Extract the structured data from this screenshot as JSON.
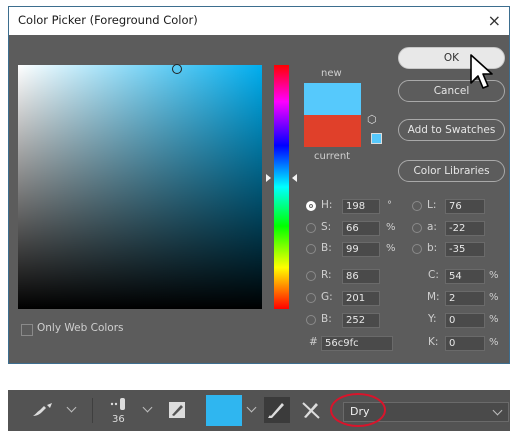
{
  "dialog": {
    "title": "Color Picker (Foreground Color)",
    "close": "×",
    "labels": {
      "new": "new",
      "current": "current"
    },
    "buttons": {
      "ok": "OK",
      "cancel": "Cancel",
      "add_to_swatches": "Add to Swatches",
      "color_libraries": "Color Libraries"
    },
    "colors": {
      "new": "#56c9fc",
      "current": "#e0402a"
    },
    "fields": {
      "hsb": [
        {
          "label": "H:",
          "value": "198",
          "unit": "°"
        },
        {
          "label": "S:",
          "value": "66",
          "unit": "%"
        },
        {
          "label": "B:",
          "value": "99",
          "unit": "%"
        }
      ],
      "rgb": [
        {
          "label": "R:",
          "value": "86"
        },
        {
          "label": "G:",
          "value": "201"
        },
        {
          "label": "B:",
          "value": "252"
        }
      ],
      "lab": [
        {
          "label": "L:",
          "value": "76"
        },
        {
          "label": "a:",
          "value": "-22"
        },
        {
          "label": "b:",
          "value": "-35"
        }
      ],
      "cmyk": [
        {
          "label": "C:",
          "value": "54",
          "unit": "%"
        },
        {
          "label": "M:",
          "value": "2",
          "unit": "%"
        },
        {
          "label": "Y:",
          "value": "0",
          "unit": "%"
        },
        {
          "label": "K:",
          "value": "0",
          "unit": "%"
        }
      ],
      "hex": {
        "label": "#",
        "value": "56c9fc"
      }
    },
    "only_web_colors": "Only Web Colors"
  },
  "toolbar": {
    "brush_size": "36",
    "swatch_color": "#2fb6f0",
    "mode_value": "Dry",
    "highlight_color": "#d9142b"
  }
}
